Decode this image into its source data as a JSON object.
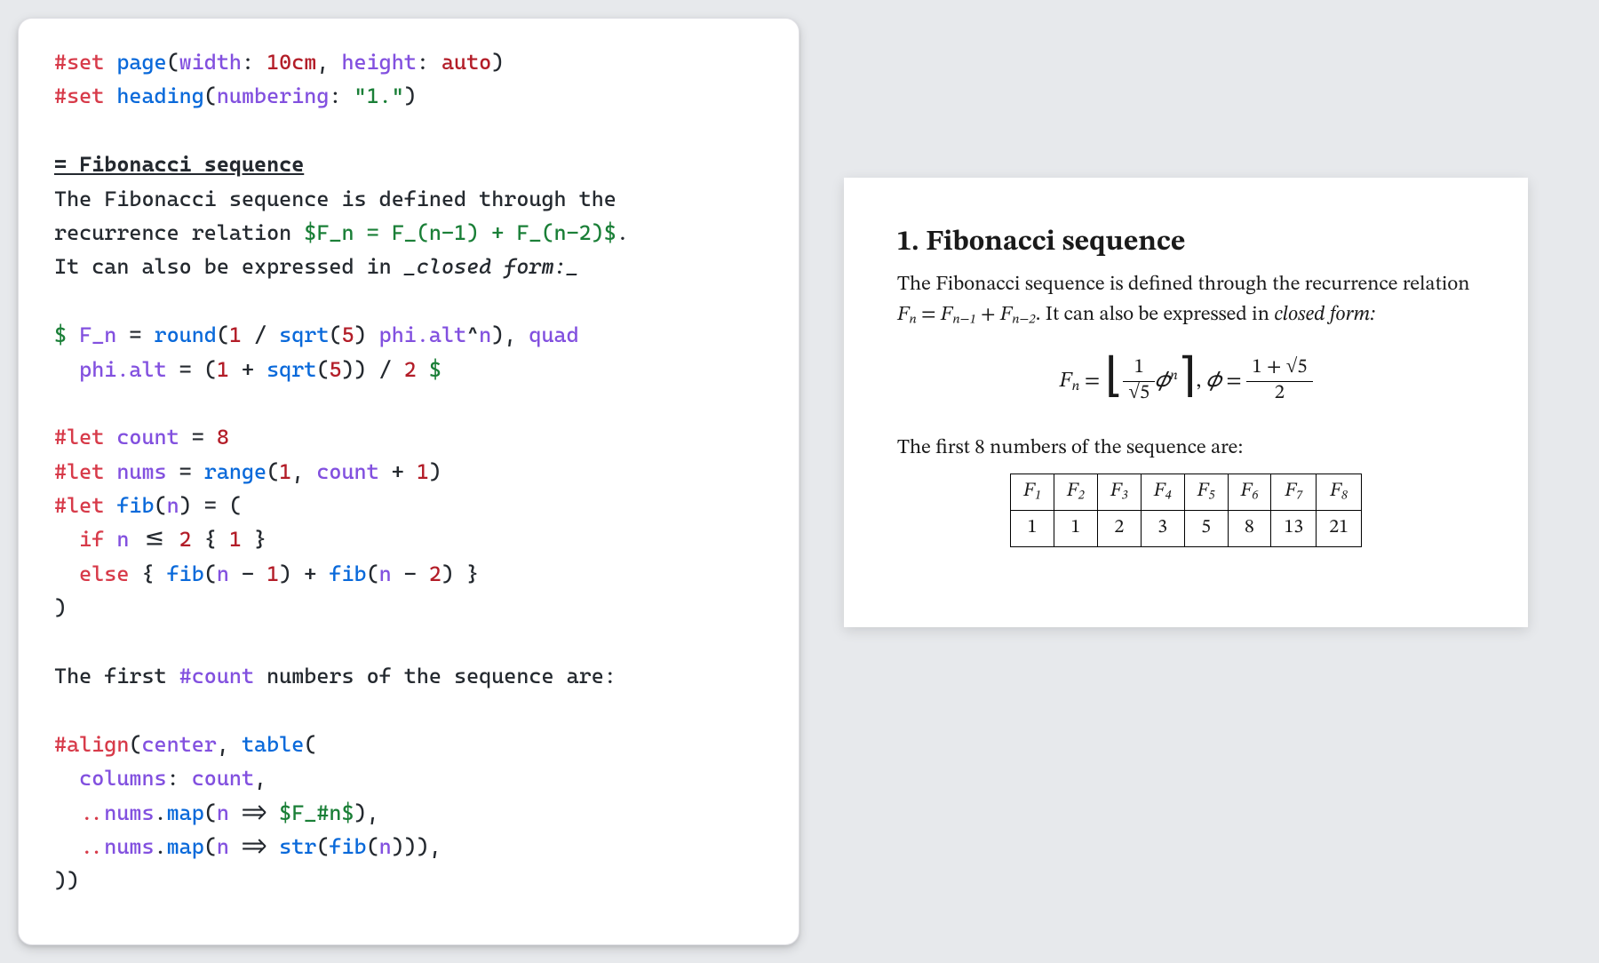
{
  "code": {
    "line1": {
      "set": "#set ",
      "fn": "page",
      "open": "(",
      "k1": "width",
      "c1": ": ",
      "v1": "10cm",
      "sep": ", ",
      "k2": "height",
      "c2": ": ",
      "v2": "auto",
      "close": ")"
    },
    "line2": {
      "set": "#set ",
      "fn": "heading",
      "open": "(",
      "k1": "numbering",
      "c1": ": ",
      "v1": "\"1.\"",
      "close": ")"
    },
    "line4": {
      "hdr": "= Fibonacci sequence"
    },
    "line5": {
      "t": "The Fibonacci sequence is defined through the"
    },
    "line6": {
      "t1": "recurrence relation ",
      "m": "$F_n = F_(n-1) + F_(n-2)$",
      "t2": "."
    },
    "line7": {
      "t1": "It can also be expressed in ",
      "em": "_closed form:_"
    },
    "line9": {
      "dollar1": "$ ",
      "v1": "F_n",
      "eq": " = ",
      "fn1": "round",
      "p1": "(",
      "one": "1",
      "sl1": " / ",
      "fn2": "sqrt",
      "p2": "(",
      "five": "5",
      "p3": ") ",
      "v2": "phi.alt",
      "caret": "^",
      "v3": "n",
      "p4": "), ",
      "v4": "quad"
    },
    "line10": {
      "pad": "  ",
      "v1": "phi.alt",
      "eq": " = (",
      "one": "1",
      "plus": " + ",
      "fn": "sqrt",
      "p1": "(",
      "five": "5",
      "p2": ")) / ",
      "two": "2",
      "dollar": " $"
    },
    "line12": {
      "let": "#let ",
      "name": "count",
      "eq": " = ",
      "val": "8"
    },
    "line13": {
      "let": "#let ",
      "name": "nums",
      "eq": " = ",
      "fn": "range",
      "p1": "(",
      "one": "1",
      "sep": ", ",
      "cnt": "count",
      "plus": " + ",
      "one2": "1",
      "p2": ")"
    },
    "line14": {
      "let": "#let ",
      "fn": "fib",
      "p1": "(",
      "n": "n",
      "p2": ") = ("
    },
    "line15": {
      "pad": "  ",
      "if": "if ",
      "n": "n",
      "cmp": " <= ",
      "two": "2",
      "body": " { ",
      "one": "1",
      "body2": " }"
    },
    "line16": {
      "pad": "  ",
      "else": "else ",
      "b1": "{ ",
      "fn1": "fib",
      "p1": "(",
      "n1": "n",
      "m1": " - ",
      "one": "1",
      "p2": ") + ",
      "fn2": "fib",
      "p3": "(",
      "n2": "n",
      "m2": " - ",
      "two": "2",
      "p4": ") }"
    },
    "line17": {
      "t": ")"
    },
    "line19": {
      "t1": "The first ",
      "k": "#count",
      "t2": " numbers of the sequence are:"
    },
    "line21": {
      "k": "#align",
      "p1": "(",
      "arg1": "center",
      "sep": ", ",
      "fn": "table",
      "p2": "("
    },
    "line22": {
      "pad": "  ",
      "k": "columns",
      "c": ": ",
      "v": "count",
      "comma": ","
    },
    "line23": {
      "pad": "  ",
      "sp": "..",
      "v": "nums",
      "dot": ".",
      "fn": "map",
      "p1": "(",
      "n": "n",
      "arr": " => ",
      "m": "$F_#n$",
      "p2": "),"
    },
    "line24": {
      "pad": "  ",
      "sp": "..",
      "v": "nums",
      "dot": ".",
      "fn": "map",
      "p1": "(",
      "n": "n",
      "arr": " => ",
      "fn2": "str",
      "p2": "(",
      "fn3": "fib",
      "p3": "(",
      "n2": "n",
      "p4": "))),"
    },
    "line25": {
      "t": "))"
    }
  },
  "preview": {
    "heading": "1. Fibonacci sequence",
    "para1a": "The Fibonacci sequence is defined through the recurrence relation ",
    "para1b": ". It can also be expressed in ",
    "para1em": "closed form:",
    "formula": {
      "F": "F",
      "n": "n",
      "eq1": " = ",
      "one": "1",
      "sqrt5": "√5",
      "phi": "𝜙",
      "exp": "n",
      "comma": ",   ",
      "phi2": "𝜙",
      "eq2": " = ",
      "num2": "1 + √5",
      "den2": "2"
    },
    "para2": "The first 8 numbers of the sequence are:",
    "table": {
      "headers": [
        "F1",
        "F2",
        "F3",
        "F4",
        "F5",
        "F6",
        "F7",
        "F8"
      ],
      "values": [
        "1",
        "1",
        "2",
        "3",
        "5",
        "8",
        "13",
        "21"
      ]
    }
  },
  "chart_data": {
    "type": "table",
    "title": "Fibonacci sequence",
    "columns": [
      "F1",
      "F2",
      "F3",
      "F4",
      "F5",
      "F6",
      "F7",
      "F8"
    ],
    "rows": [
      [
        1,
        1,
        2,
        3,
        5,
        8,
        13,
        21
      ]
    ]
  }
}
